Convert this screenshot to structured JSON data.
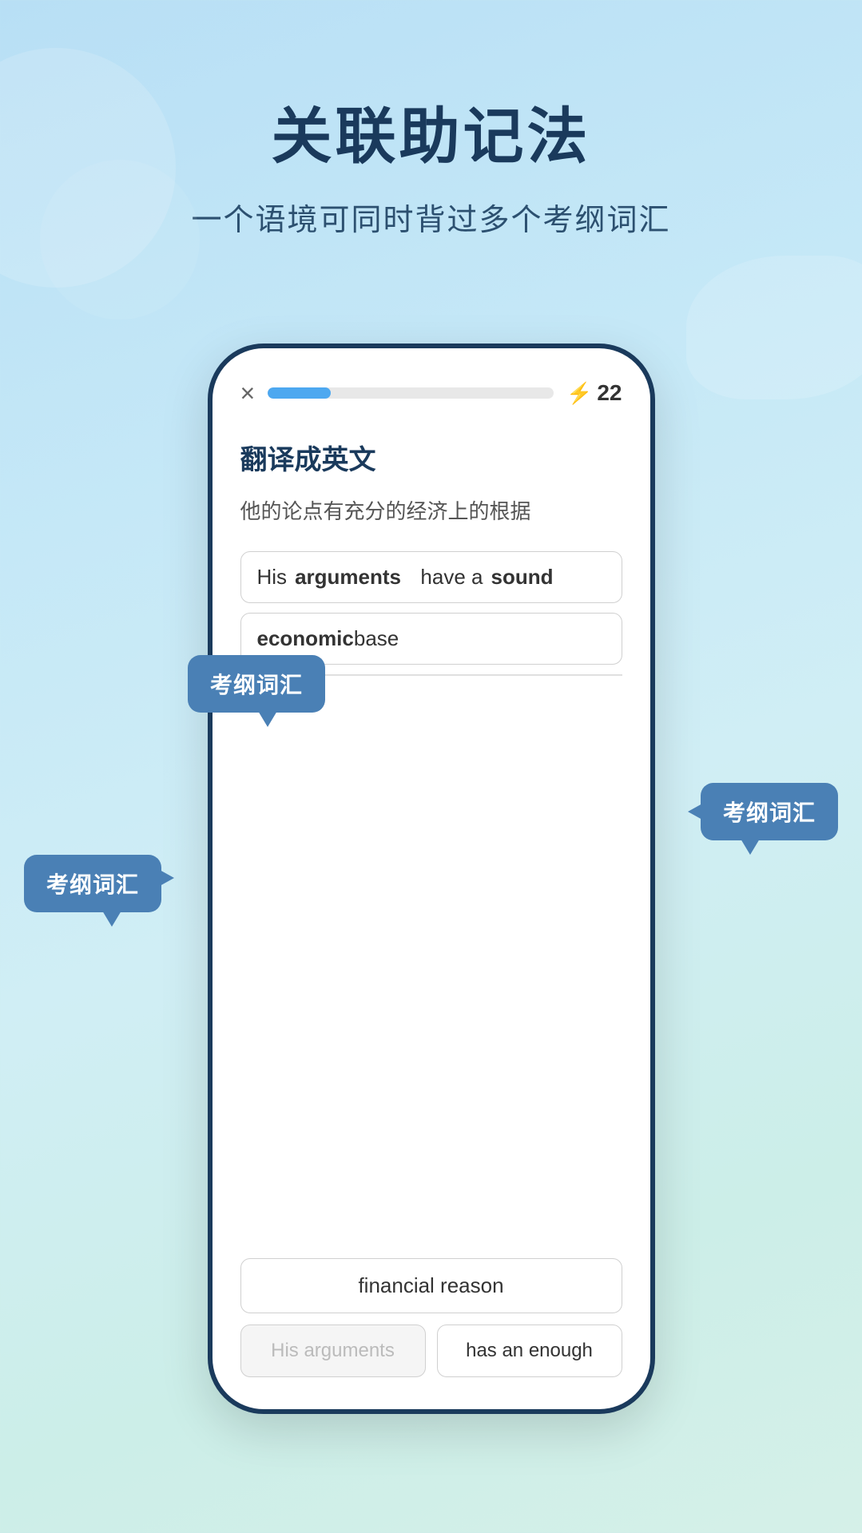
{
  "page": {
    "background": "linear-gradient(160deg, #b8dff5, #c5e8f7, #d0eef5, #cceee8, #d5f0e8)"
  },
  "title_section": {
    "main_title": "关联助记法",
    "subtitle": "一个语境可同时背过多个考纲词汇"
  },
  "phone": {
    "top_bar": {
      "close_label": "×",
      "progress_percent": 22,
      "score_label": "22"
    },
    "question_type": "翻译成英文",
    "chinese_prompt": "他的论点有充分的经济上的根据",
    "answer_line1_part1": "His ",
    "answer_line1_bold1": "arguments",
    "answer_line1_part2": "  have a ",
    "answer_line1_bold2": "sound",
    "answer_line2_bold": "economic",
    "answer_line2_part": " base",
    "bottom_options": [
      {
        "id": "opt1",
        "text": "financial reason",
        "dimmed": false
      },
      {
        "id": "opt2a",
        "text": "His arguments",
        "dimmed": true
      },
      {
        "id": "opt2b",
        "text": "has an enough",
        "dimmed": false
      }
    ]
  },
  "tooltips": [
    {
      "id": "tooltip-1",
      "label": "考纲词汇",
      "position": "top-center"
    },
    {
      "id": "tooltip-2",
      "label": "考纲词汇",
      "position": "right"
    },
    {
      "id": "tooltip-3",
      "label": "考纲词汇",
      "position": "left"
    }
  ]
}
